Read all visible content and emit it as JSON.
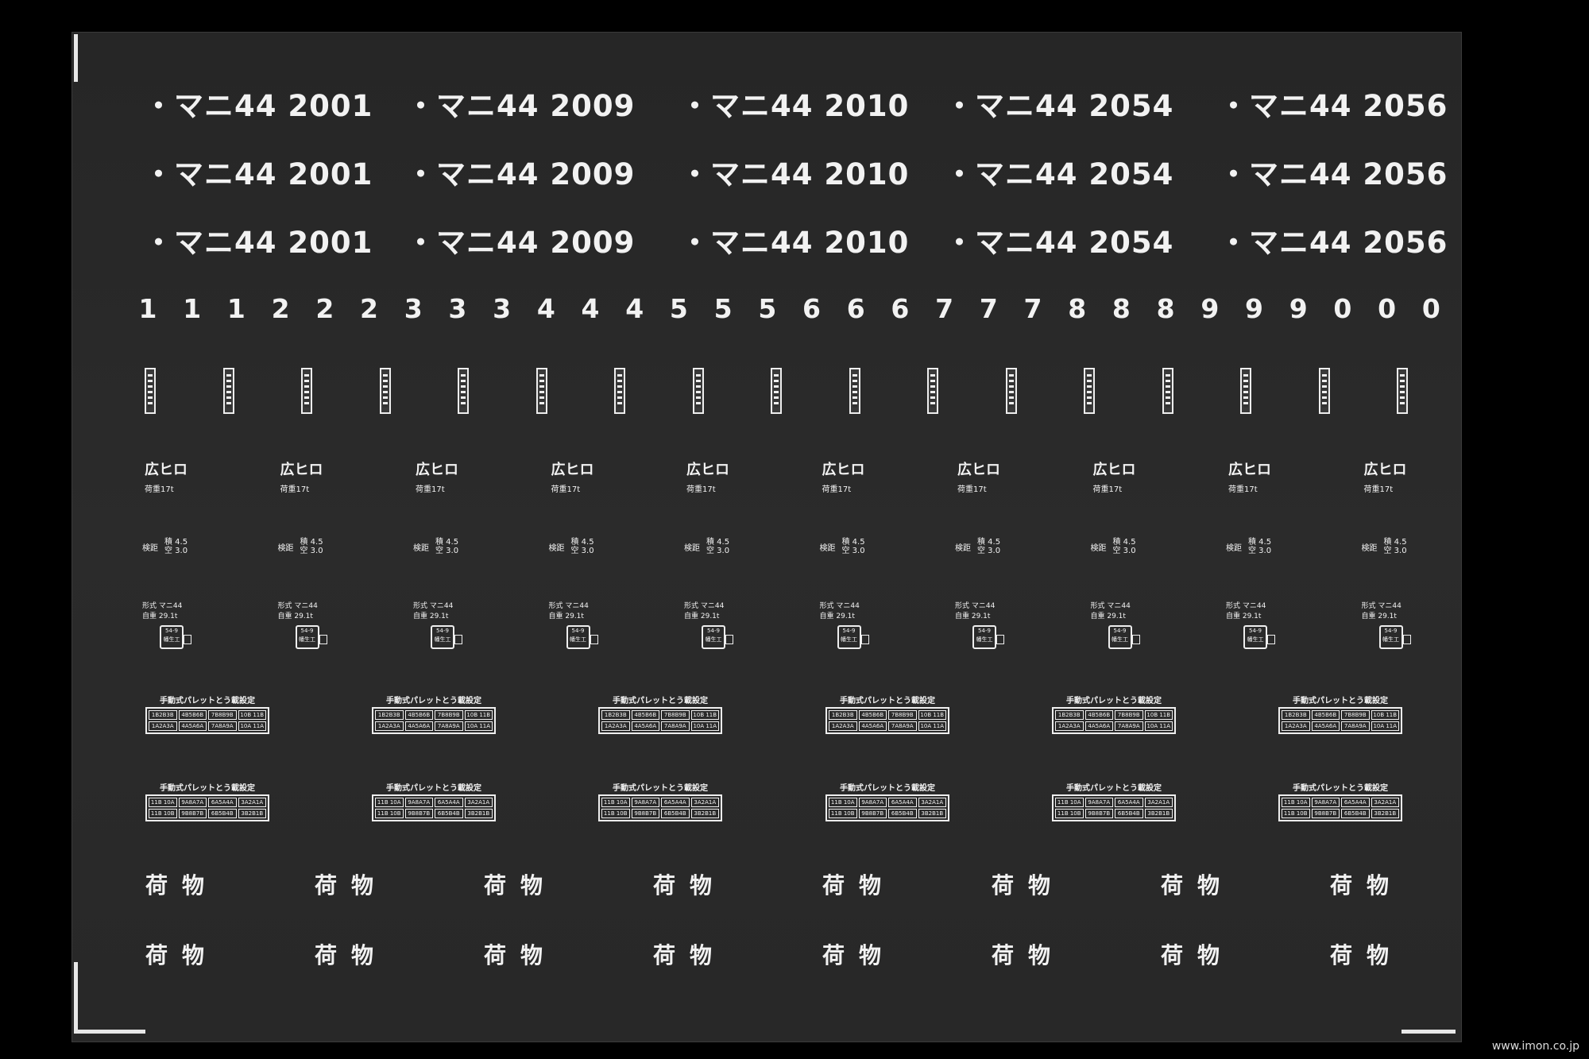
{
  "car_numbers": [
    [
      "・マニ44 2001",
      "・マニ44 2009",
      "・マニ44 2010",
      "・マニ44 2054",
      "・マニ44 2056"
    ],
    [
      "・マニ44 2001",
      "・マニ44 2009",
      "・マニ44 2010",
      "・マニ44 2054",
      "・マニ44 2056"
    ],
    [
      "・マニ44 2001",
      "・マニ44 2009",
      "・マニ44 2010",
      "・マニ44 2054",
      "・マニ44 2056"
    ]
  ],
  "digits": [
    "1",
    "1",
    "1",
    "2",
    "2",
    "2",
    "3",
    "3",
    "3",
    "4",
    "4",
    "4",
    "5",
    "5",
    "5",
    "6",
    "6",
    "6",
    "7",
    "7",
    "7",
    "8",
    "8",
    "8",
    "9",
    "9",
    "9",
    "0",
    "0",
    "0"
  ],
  "depot_labels": [
    {
      "mark": "広ヒロ",
      "capacity": "荷重17t"
    },
    {
      "mark": "広ヒロ",
      "capacity": "荷重17t"
    },
    {
      "mark": "広ヒロ",
      "capacity": "荷重17t"
    },
    {
      "mark": "広ヒロ",
      "capacity": "荷重17t"
    },
    {
      "mark": "広ヒロ",
      "capacity": "荷重17t"
    },
    {
      "mark": "広ヒロ",
      "capacity": "荷重17t"
    },
    {
      "mark": "広ヒロ",
      "capacity": "荷重17t"
    },
    {
      "mark": "広ヒロ",
      "capacity": "荷重17t"
    },
    {
      "mark": "広ヒロ",
      "capacity": "荷重17t"
    },
    {
      "mark": "広ヒロ",
      "capacity": "荷重17t"
    }
  ],
  "spec_label": {
    "key": "検距",
    "full": "積 4.5",
    "empty": "空 3.0"
  },
  "inspection_label": {
    "type": "形式 マニ44",
    "weight": "自重 29.1t",
    "box_top": "54-9",
    "box_bottom": "幡生工"
  },
  "pallet_table": {
    "title": "手動式パレットとう載設定",
    "row_a": [
      "1B2B3B",
      "4B5B6B",
      "7B8B9B",
      "10B 11B"
    ],
    "row_b": [
      "1A2A3A",
      "4A5A6A",
      "7A8A9A",
      "10A 11A"
    ],
    "row_c": [
      "11B 10A",
      "9A8A7A",
      "6A5A4A",
      "3A2A1A"
    ],
    "row_d": [
      "11B 10B",
      "9B8B7B",
      "6B5B4B",
      "3B2B1B"
    ]
  },
  "cargo_text": "荷物",
  "watermark": "www.imon.co.jp"
}
